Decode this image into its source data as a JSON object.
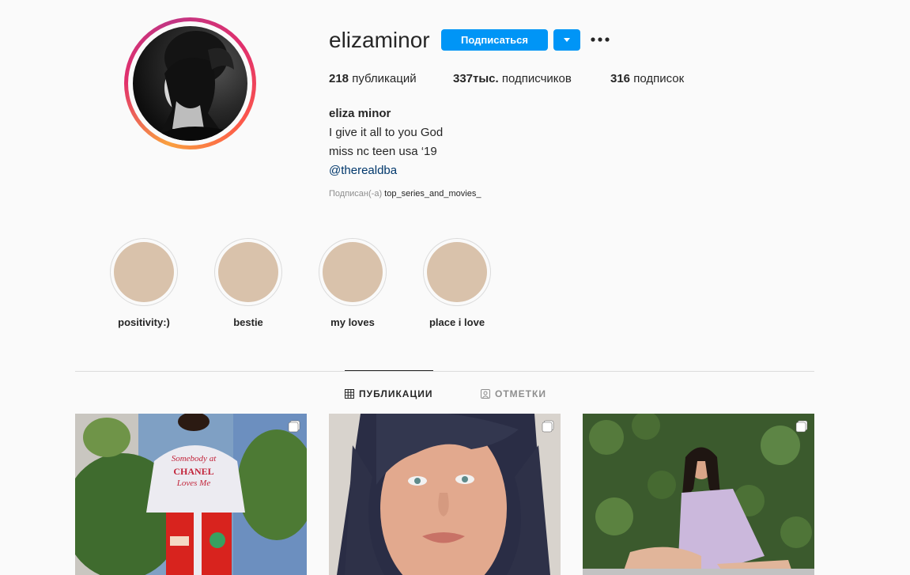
{
  "profile": {
    "username": "elizaminor",
    "follow_label": "Подписаться",
    "stats": {
      "posts_count": "218",
      "posts_label": "публикаций",
      "followers_count": "337тыс.",
      "followers_label": "подписчиков",
      "following_count": "316",
      "following_label": "подписок"
    },
    "bio": {
      "name": "eliza minor",
      "line1": "I give it all to you God",
      "line2": "miss nc teen usa ‘19",
      "mention": "@therealdba"
    },
    "followed_by_prefix": "Подписан(-а)",
    "followed_by_user": "top_series_and_movies_"
  },
  "highlights": [
    {
      "label": "positivity:)"
    },
    {
      "label": "bestie"
    },
    {
      "label": "my loves"
    },
    {
      "label": "place i love"
    }
  ],
  "tabs": {
    "posts": "ПУБЛИКАЦИИ",
    "tagged": "ОТМЕТКИ"
  },
  "icons": {
    "dropdown": "chevron-down-icon",
    "more": "more-options-icon",
    "grid": "grid-icon",
    "tagged": "tagged-user-icon",
    "carousel": "multiple-photos-icon"
  },
  "colors": {
    "primary_button": "#0095f6",
    "link": "#00376b",
    "muted": "#8e8e8e",
    "highlight_fill": "#d9c2ab"
  }
}
